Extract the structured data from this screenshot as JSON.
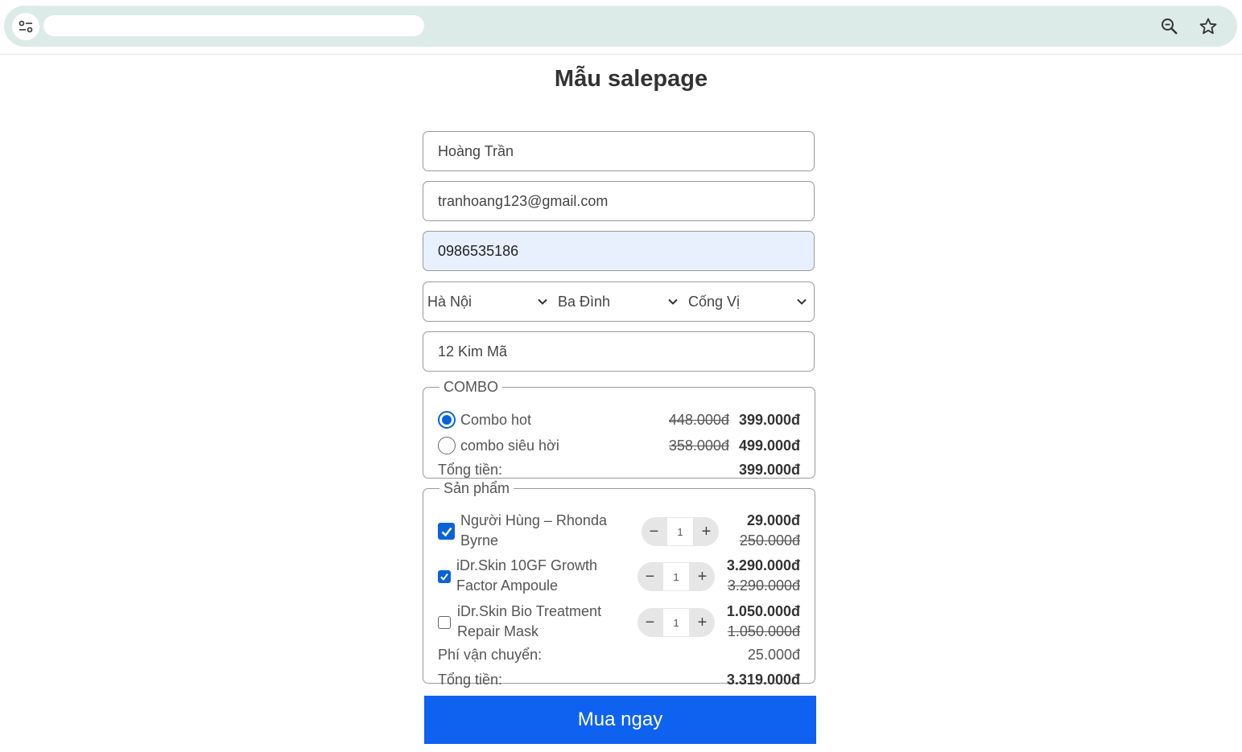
{
  "browser": {
    "site_icon": "tune-icon",
    "zoom_icon": "zoom-out-icon",
    "bookmark_icon": "star-icon"
  },
  "page": {
    "title": "Mẫu salepage"
  },
  "form": {
    "name": "Hoàng Trần",
    "email": "tranhoang123@gmail.com",
    "phone": "0986535186",
    "province": "Hà Nội",
    "district": "Ba Đình",
    "ward": "Cống Vị",
    "address": "12 Kim Mã"
  },
  "combo": {
    "legend": "COMBO",
    "options": [
      {
        "label": "Combo hot",
        "old_price": "448.000đ",
        "price": "399.000đ",
        "selected": true
      },
      {
        "label": "combo siêu hời",
        "old_price": "358.000đ",
        "price": "499.000đ",
        "selected": false
      }
    ],
    "total_label": "Tổng tiền:",
    "total_value": "399.000đ"
  },
  "products": {
    "legend": "Sản phẩm",
    "items": [
      {
        "name_line1": "Người Hùng – Rhonda",
        "name_line2": "Byrne",
        "qty": "1",
        "price": "29.000đ",
        "old_price": "250.000đ",
        "checked": true
      },
      {
        "name_line1": "iDr.Skin 10GF Growth",
        "name_line2": "Factor Ampoule",
        "qty": "1",
        "price": "3.290.000đ",
        "old_price": "3.290.000đ",
        "checked": true
      },
      {
        "name_line1": "iDr.Skin Bio Treatment",
        "name_line2": "Repair Mask",
        "qty": "1",
        "price": "1.050.000đ",
        "old_price": "1.050.000đ",
        "checked": false
      }
    ],
    "shipping_label": "Phí vận chuyển:",
    "shipping_value": "25.000đ",
    "total_label": "Tổng tiền:",
    "total_value": "3.319.000đ"
  },
  "buy_button": "Mua ngay",
  "colors": {
    "accent": "#0f62f0",
    "omnibox": "#dcebe7",
    "autofill": "#e8f0fe"
  }
}
